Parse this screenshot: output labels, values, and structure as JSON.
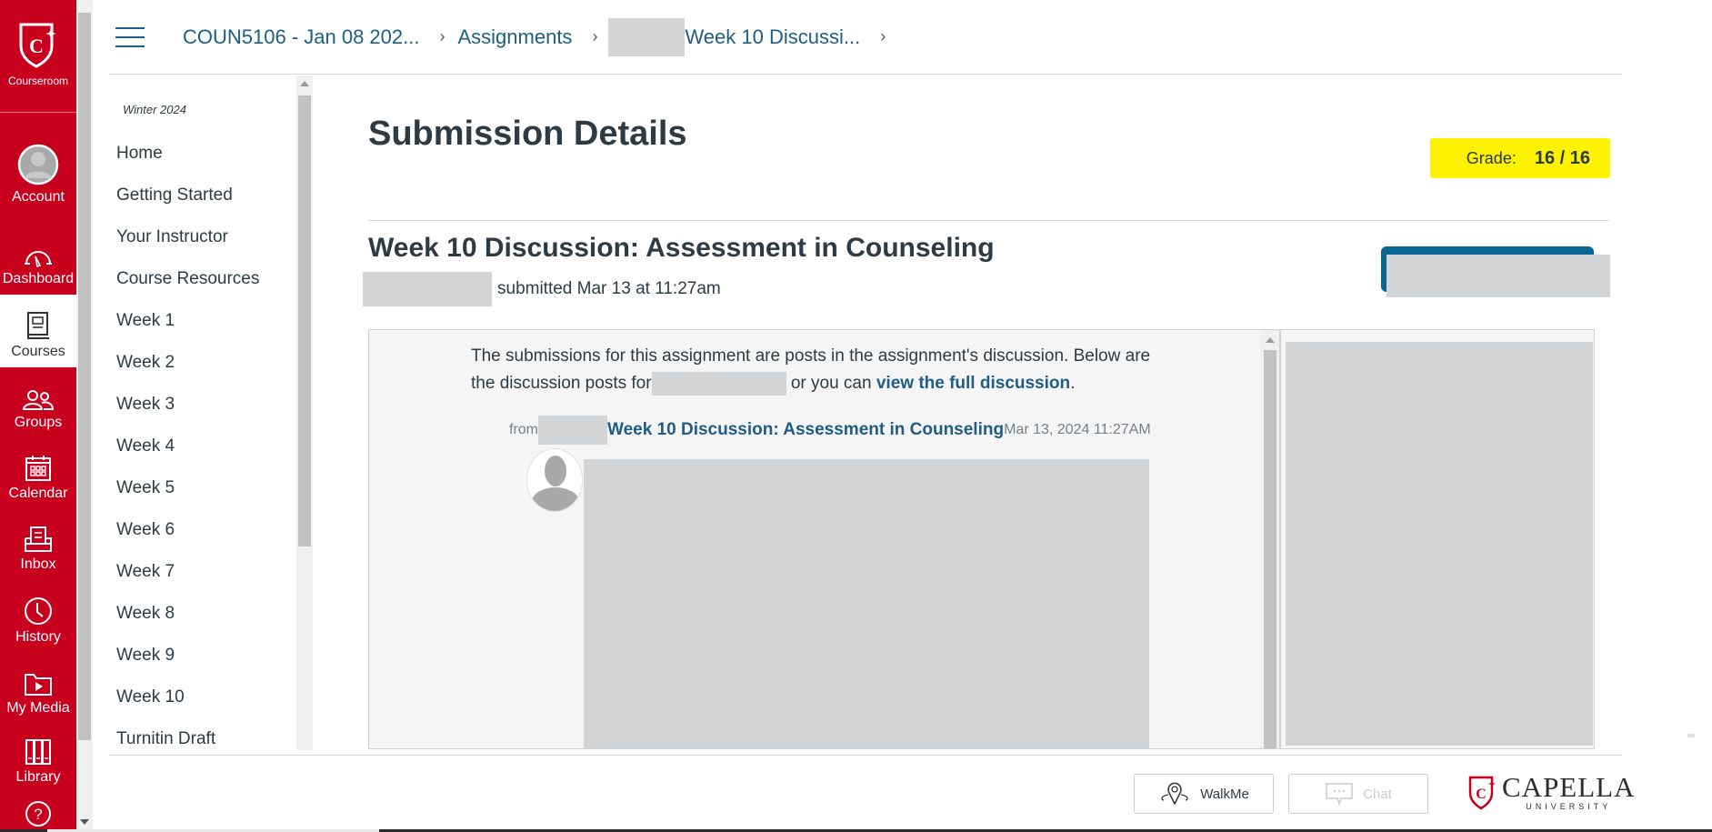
{
  "global_nav": {
    "logo_label": "Courseroom",
    "items": [
      {
        "label": "Account",
        "icon": "account-avatar-icon",
        "active": false
      },
      {
        "label": "Dashboard",
        "icon": "dashboard-gauge-icon",
        "active": false
      },
      {
        "label": "Courses",
        "icon": "courses-book-icon",
        "active": true
      },
      {
        "label": "Groups",
        "icon": "groups-people-icon",
        "active": false
      },
      {
        "label": "Calendar",
        "icon": "calendar-icon",
        "active": false
      },
      {
        "label": "Inbox",
        "icon": "inbox-tray-icon",
        "active": false
      },
      {
        "label": "History",
        "icon": "history-clock-icon",
        "active": false
      },
      {
        "label": "My Media",
        "icon": "my-media-folder-icon",
        "active": false
      },
      {
        "label": "Library",
        "icon": "library-books-icon",
        "active": false
      }
    ],
    "help_icon": "help-question-icon",
    "brand_color": "#c8001e"
  },
  "breadcrumb": {
    "items": [
      {
        "label": "COUN5106 - Jan 08 202..."
      },
      {
        "label": "Assignments"
      },
      {
        "label": "Week 10 Discussi..."
      }
    ]
  },
  "course_nav": {
    "term": "Winter 2024",
    "items": [
      "Home",
      "Getting Started",
      "Your Instructor",
      "Course Resources",
      "Week 1",
      "Week 2",
      "Week 3",
      "Week 4",
      "Week 5",
      "Week 6",
      "Week 7",
      "Week 8",
      "Week 9",
      "Week 10",
      "Turnitin Draft"
    ]
  },
  "main": {
    "page_title": "Submission Details",
    "grade": {
      "label": "Grade:",
      "value": "16 / 16",
      "highlight_color": "#fff200"
    },
    "assignment_title": "Week 10 Discussion: Assessment in Counseling",
    "submitted_text": "submitted Mar 13 at 11:27am",
    "intro": {
      "part1": "The submissions for this assignment are posts in the assignment's discussion. Below are the discussion posts for",
      "part2": "or you can",
      "link": "view the full discussion",
      "end": "."
    },
    "post": {
      "from_label": "from",
      "topic_link": "Week 10 Discussion: Assessment in Counseling",
      "date": "Mar 13, 2024 11:27AM"
    },
    "link_color": "#1f5d84",
    "button_color": "#086891"
  },
  "footer": {
    "walkme_label": "WalkMe",
    "chat_label": "Chat",
    "brand_name": "CAPELLA",
    "brand_sub": "UNIVERSITY"
  }
}
